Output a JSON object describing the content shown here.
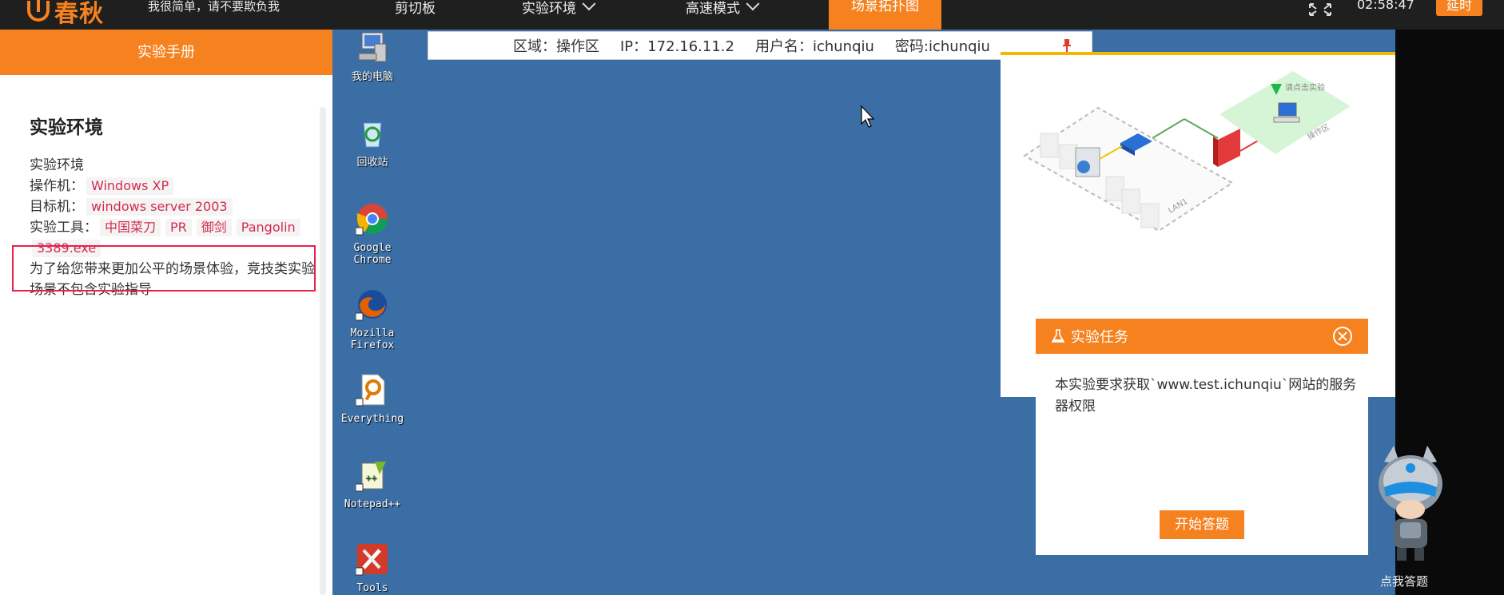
{
  "topbar": {
    "logo": "春秋",
    "slogan": "我很简单，请不要欺负我",
    "nav": [
      {
        "label": "剪切板"
      },
      {
        "label": "实验环境"
      },
      {
        "label": "高速模式"
      }
    ],
    "active_tab": "场景拓扑图",
    "clock": "02:58:47",
    "extend_label": "延时"
  },
  "manual": {
    "header": "实验手册",
    "title": "实验环境",
    "line1": "实验环境",
    "op_label": "操作机：",
    "op_value": "Windows XP",
    "target_label": "目标机：",
    "target_value": "windows server 2003",
    "tools_label": "实验工具：",
    "tools": [
      "中国菜刀",
      "PR",
      "御剑",
      "Pangolin",
      "3389.exe"
    ],
    "note": "为了给您带来更加公平的场景体验，竞技类实验场景不包含实验指导"
  },
  "connection": {
    "zone": "区域：操作区",
    "ip": "IP：172.16.11.2",
    "user": "用户名：ichunqiu",
    "password": "密码:ichunqiu"
  },
  "desktop_icons": [
    {
      "label": "我的电脑",
      "icon": "computer-icon"
    },
    {
      "label": "回收站",
      "icon": "recycle-bin-icon"
    },
    {
      "label": "Google Chrome",
      "icon": "chrome-icon"
    },
    {
      "label": "Mozilla Firefox",
      "icon": "firefox-icon"
    },
    {
      "label": "Everything",
      "icon": "everything-icon"
    },
    {
      "label": "Notepad++",
      "icon": "notepad-icon"
    },
    {
      "label": "Tools",
      "icon": "tools-icon"
    }
  ],
  "topology": {
    "hint": "请点击实验",
    "zone_label": "操作区",
    "lan_label": "LAN1"
  },
  "task": {
    "title": "实验任务",
    "text": "本实验要求获取`www.test.ichunqiu`网站的服务器权限",
    "button": "开始答题"
  },
  "assistant": {
    "label": "点我答题"
  },
  "colors": {
    "accent": "#f5821f",
    "desktop": "#3a6ea5",
    "tag_text": "#d6294f",
    "highlight": "#e8204a"
  }
}
